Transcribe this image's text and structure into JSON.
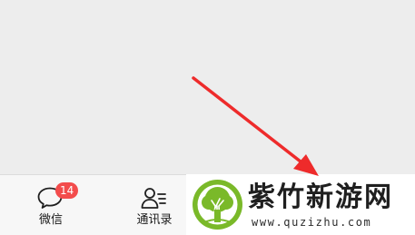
{
  "tabbar": {
    "chats": {
      "label": "微信",
      "badge": "14",
      "icon": "chat-bubble-icon"
    },
    "contacts": {
      "label": "通讯录",
      "icon": "contacts-icon"
    }
  },
  "watermark": {
    "name": "紫竹新游网",
    "url": "www.quzizhu.com",
    "logo_icon": "tree-logo-icon"
  },
  "colors": {
    "arrow": "#ee2b2b",
    "badge": "#f34c4c",
    "logo_green": "#7ab929"
  }
}
